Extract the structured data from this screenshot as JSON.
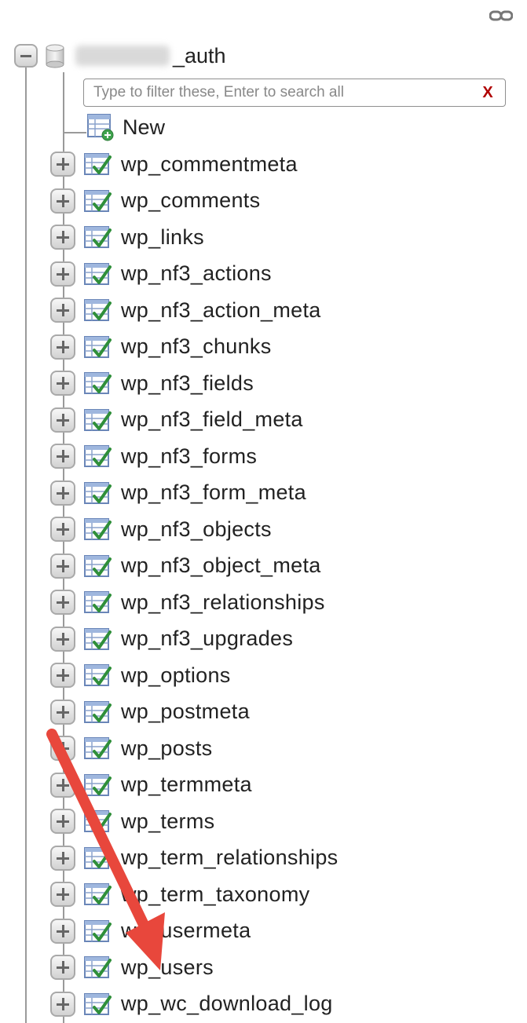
{
  "database": {
    "name_suffix": "_auth"
  },
  "filter": {
    "placeholder": "Type to filter these, Enter to search all",
    "clear_label": "X"
  },
  "new_item": {
    "label": "New"
  },
  "tables": [
    "wp_commentmeta",
    "wp_comments",
    "wp_links",
    "wp_nf3_actions",
    "wp_nf3_action_meta",
    "wp_nf3_chunks",
    "wp_nf3_fields",
    "wp_nf3_field_meta",
    "wp_nf3_forms",
    "wp_nf3_form_meta",
    "wp_nf3_objects",
    "wp_nf3_object_meta",
    "wp_nf3_relationships",
    "wp_nf3_upgrades",
    "wp_options",
    "wp_postmeta",
    "wp_posts",
    "wp_termmeta",
    "wp_terms",
    "wp_term_relationships",
    "wp_term_taxonomy",
    "wp_usermeta",
    "wp_users",
    "wp_wc_download_log"
  ],
  "colors": {
    "annotation_arrow": "#e8473c",
    "clear_button": "#b00000"
  },
  "icons": {
    "link": "chain-link-icon",
    "database": "database-cylinder-icon",
    "new_table": "new-table-icon",
    "table": "table-structure-icon"
  }
}
